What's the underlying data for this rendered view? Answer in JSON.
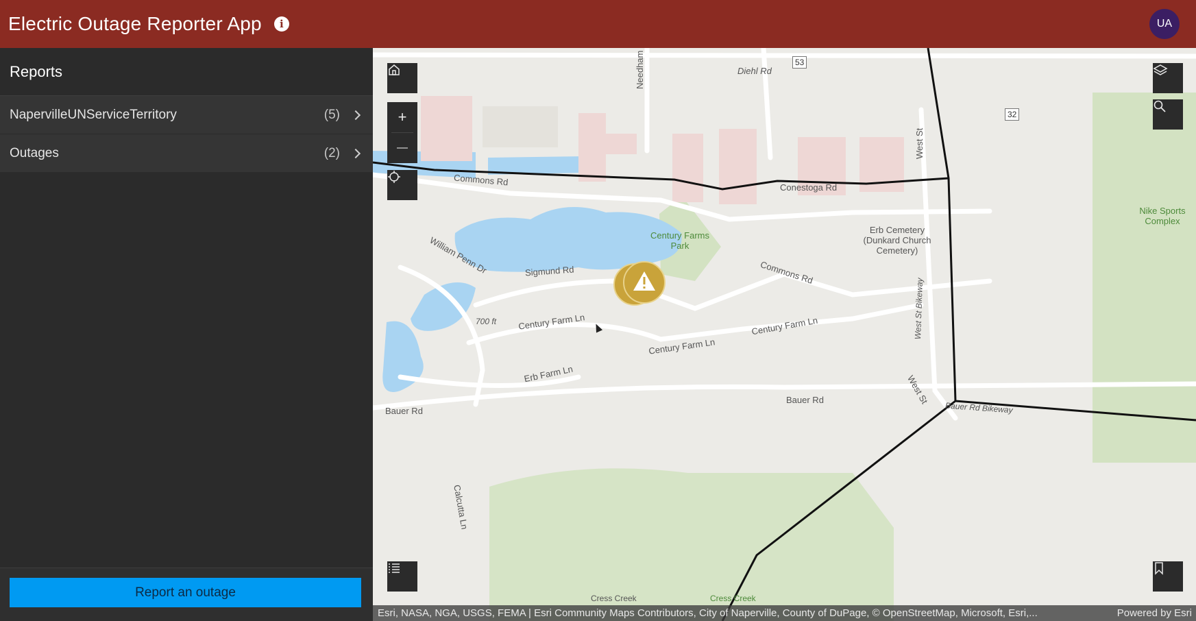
{
  "header": {
    "title": "Electric Outage Reporter App",
    "info_icon": "info-icon",
    "avatar_initials": "UA",
    "background_color": "#8b2b22",
    "avatar_color": "#3b1e63"
  },
  "sidebar": {
    "title": "Reports",
    "layers": [
      {
        "name": "NapervilleUNServiceTerritory",
        "count": "(5)"
      },
      {
        "name": "Outages",
        "count": "(2)"
      }
    ],
    "report_button": "Report an outage",
    "report_button_color": "#009af2"
  },
  "map": {
    "controls": {
      "home": "home-icon",
      "zoom_in": "+",
      "zoom_out": "—",
      "locate": "crosshair-icon",
      "layers": "layers-icon",
      "search": "search-icon",
      "legend": "list-icon",
      "bookmarks": "bookmark-icon"
    },
    "labels": {
      "diehl_rd": "Diehl Rd",
      "route_53": "53",
      "route_32": "32",
      "needham_ct": "Needham Ct",
      "west_st": "West St",
      "commons_rd": "Commons Rd",
      "conestoga_rd": "Conestoga Rd",
      "william_penn_dr": "William Penn Dr",
      "century_farms_park": "Century Farms Park",
      "sigmund_rd": "Sigmund Rd",
      "commons_rd_2": "Commons Rd",
      "erb_cemetery": "Erb Cemetery (Dunkard Church Cemetery)",
      "nike_sports": "Nike Sports Complex",
      "elevation": "700 ft",
      "century_farm_ln_1": "Century Farm Ln",
      "century_farm_ln_2": "Century Farm Ln",
      "century_farm_ln_3": "Century Farm Ln",
      "west_st_bikeway": "West St Bikeway",
      "west_st_2": "West St",
      "erb_farm_ln": "Erb Farm Ln",
      "bauer_rd_1": "Bauer Rd",
      "bauer_rd_2": "Bauer Rd",
      "bauer_rd_bikeway": "Bauer Rd Bikeway",
      "calcutta_ln": "Calcutta Ln",
      "cress_creek_1": "Cress Creek",
      "cress_creek_2": "Cress Creek"
    },
    "attribution": "Esri, NASA, NGA, USGS, FEMA | Esri Community Maps Contributors, City of Naperville, County of DuPage, © OpenStreetMap, Microsoft, Esri,...",
    "powered_by": "Powered by Esri",
    "marker_color": "#c9a33a"
  }
}
